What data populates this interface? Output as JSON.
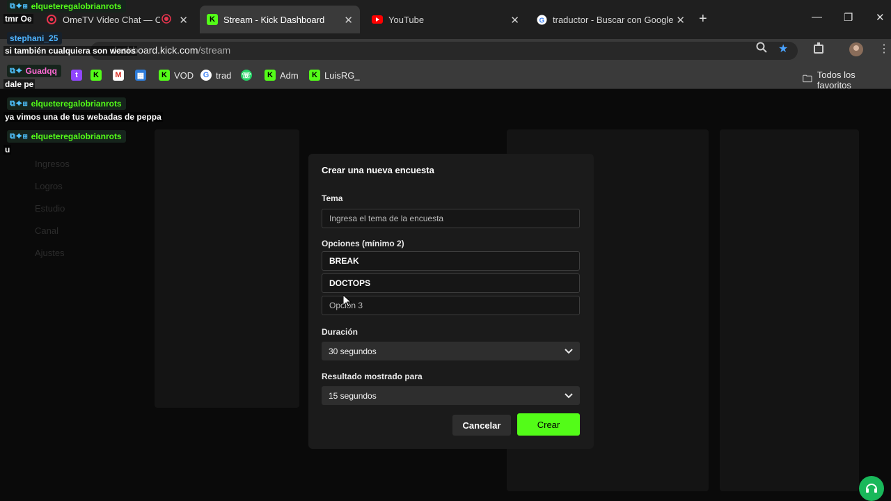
{
  "browser": {
    "tabs": [
      {
        "label": "OmeTV Video Chat — Ome",
        "active": false
      },
      {
        "label": "Stream - Kick Dashboard",
        "active": true
      },
      {
        "label": "YouTube",
        "active": false
      },
      {
        "label": "traductor - Buscar con Google",
        "active": false
      }
    ],
    "url_host": "dashboard.kick.com",
    "url_path": "/stream",
    "bookmarks": [
      {
        "label": "VOD"
      },
      {
        "label": "trad"
      },
      {
        "label": "Adm"
      },
      {
        "label": "LuisRG_"
      }
    ],
    "all_bookmarks_label": "Todos los favoritos"
  },
  "overlay_chat": [
    {
      "user": "elqueteregalobrianrots",
      "message": "tmr Oe"
    },
    {
      "user": "stephani_25",
      "message": "si también cualquiera son wenos"
    },
    {
      "user": "Guadqq",
      "message": "dale pe"
    },
    {
      "user": "elqueteregalobrianrots",
      "message": "ya vimos una de tus webadas de peppa"
    },
    {
      "user": "elqueteregalobrianrots",
      "message": "u"
    }
  ],
  "background_nav": [
    "Ingresos",
    "Logros",
    "Estudio",
    "Canal",
    "Ajustes"
  ],
  "modal": {
    "title": "Crear una nueva encuesta",
    "topic_label": "Tema",
    "topic_placeholder": "Ingresa el tema de la encuesta",
    "options_label": "Opciones (mínimo 2)",
    "options": [
      "BREAK",
      "DOCTOPS"
    ],
    "option3_placeholder": "Opción 3",
    "duration_label": "Duración",
    "duration_value": "30 segundos",
    "result_label": "Resultado mostrado para",
    "result_value": "15 segundos",
    "cancel_label": "Cancelar",
    "create_label": "Crear"
  },
  "colors": {
    "kick_green": "#53fc18",
    "modal_bg": "#1b1b1b"
  }
}
